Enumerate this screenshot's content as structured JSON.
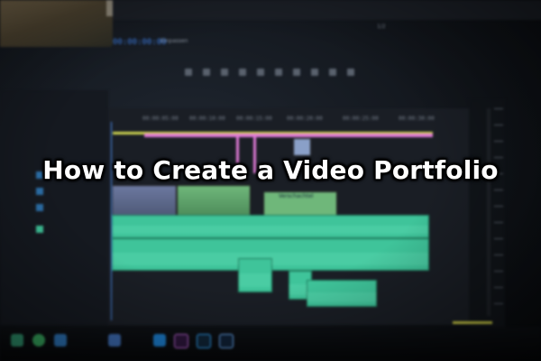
{
  "headline": "How to Create a Video Portfolio",
  "editor": {
    "timecode": "00:00:00:00",
    "fit_label": "Einpassen",
    "page_count": "1/2",
    "ruler_ticks": [
      "00:00:05:00",
      "00:00:10:00",
      "00:00:15:00",
      "00:00:20:00",
      "00:00:25:00",
      "00:00:30:00"
    ],
    "clip_label": "Verschachtel"
  },
  "colors": {
    "timecode": "#3b7be0",
    "audio_clip": "#3fc49a",
    "video_clip": "#6c78a0",
    "marker_pink": "#e07ad6",
    "ruler_yellow": "#cfd650"
  },
  "taskbar_icons": [
    "premiere-pro-icon",
    "photoshop-icon",
    "lightroom-icon",
    "media-encoder-icon"
  ]
}
